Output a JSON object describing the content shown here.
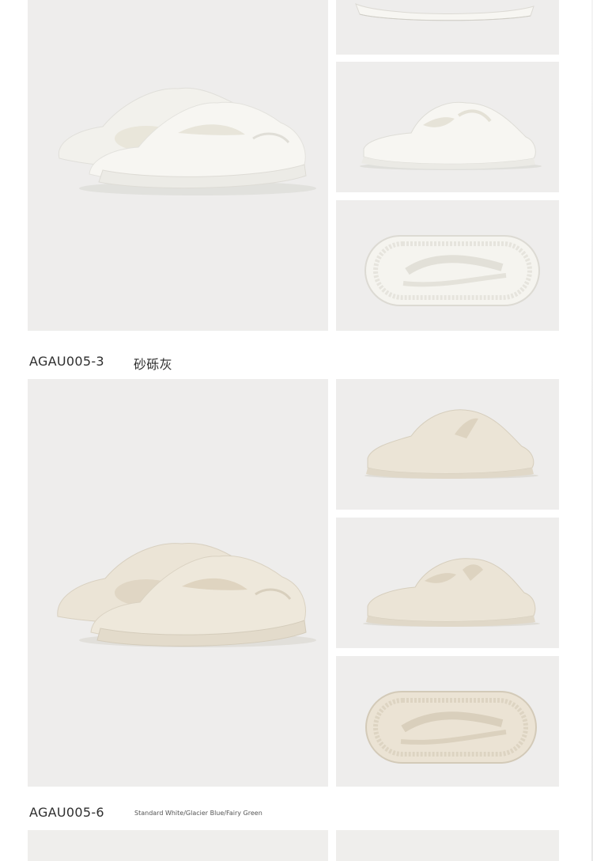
{
  "sections": [
    {
      "code": "AGAU005-3",
      "color_name": "砂砾灰"
    },
    {
      "code": "AGAU005-6",
      "color_name": "Standard White/Glacier Blue/Fairy Green"
    }
  ],
  "images": [
    {
      "name": "white-slide-pair-photo",
      "tone": "#f4f3ef"
    },
    {
      "name": "white-slide-side-photo",
      "tone": "#f4f3ef"
    },
    {
      "name": "white-slide-angle-photo",
      "tone": "#f4f3ef"
    },
    {
      "name": "white-slide-sole-photo",
      "tone": "#f4f3ef"
    },
    {
      "name": "grey-slide-pair-photo",
      "tone": "#e9e1d2"
    },
    {
      "name": "grey-slide-side-photo",
      "tone": "#e9e1d2"
    },
    {
      "name": "grey-slide-angle-photo",
      "tone": "#e9e1d2"
    },
    {
      "name": "grey-slide-sole-photo",
      "tone": "#e9e1d2"
    }
  ]
}
